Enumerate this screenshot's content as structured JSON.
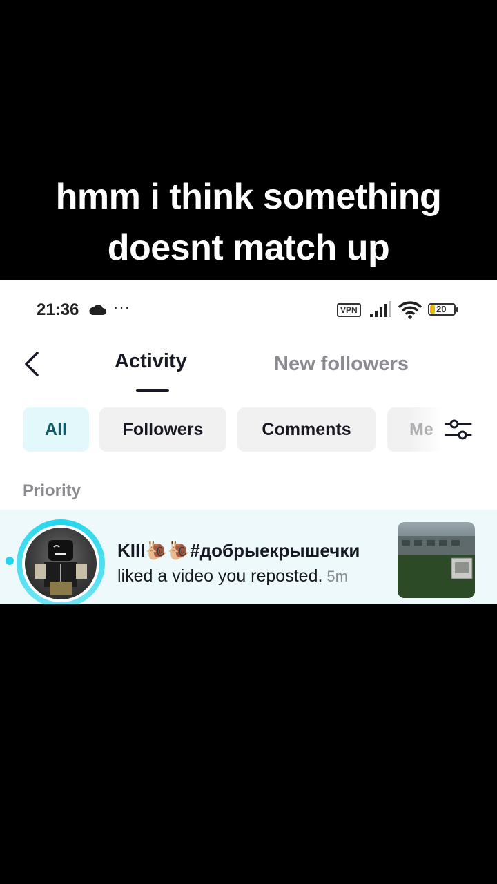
{
  "caption": {
    "line1": "hmm i think something",
    "line2": "doesnt match up"
  },
  "status_bar": {
    "time": "21:36",
    "dots": "···",
    "vpn": "VPN",
    "battery": "20"
  },
  "header": {
    "tab_activity": "Activity",
    "tab_new_followers": "New followers"
  },
  "filters": {
    "all": "All",
    "followers": "Followers",
    "comments": "Comments",
    "more": "Me"
  },
  "section": {
    "title": "Priority"
  },
  "notification": {
    "username": "KIll🐌🐌#добрыекрышечки",
    "message": "liked a video you reposted.",
    "time": "5m"
  },
  "colors": {
    "accent": "#20d5ec",
    "active_chip_bg": "#e3f8fb",
    "row_bg": "#eef9fb"
  }
}
